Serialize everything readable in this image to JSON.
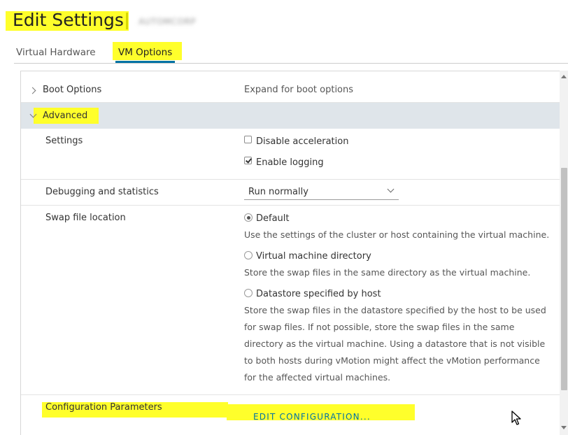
{
  "header": {
    "title": "Edit Settings",
    "vm_name": "AUTOMCORP"
  },
  "tabs": [
    {
      "label": "Virtual Hardware",
      "active": false
    },
    {
      "label": "VM Options",
      "active": true
    }
  ],
  "boot_options": {
    "label": "Boot Options",
    "value": "Expand for boot options"
  },
  "advanced": {
    "label": "Advanced",
    "settings": {
      "label": "Settings",
      "disable_acceleration": {
        "label": "Disable acceleration",
        "checked": false
      },
      "enable_logging": {
        "label": "Enable logging",
        "checked": true
      }
    },
    "debugging": {
      "label": "Debugging and statistics",
      "selected": "Run normally"
    },
    "swap": {
      "label": "Swap file location",
      "options": [
        {
          "label": "Default",
          "checked": true,
          "desc": [
            "Use the settings of the cluster or host containing the virtual machine."
          ]
        },
        {
          "label": "Virtual machine directory",
          "checked": false,
          "desc": [
            "Store the swap files in the same directory as the virtual machine."
          ]
        },
        {
          "label": "Datastore specified by host",
          "checked": false,
          "desc": [
            "Store the swap files in the datastore specified by the host to be used",
            "for swap files. If not possible, store the swap files in the same",
            "directory as the virtual machine. Using a datastore that is not visible",
            "to both hosts during vMotion might affect the vMotion performance",
            "for the affected virtual machines."
          ]
        }
      ]
    },
    "config_params": {
      "label": "Configuration Parameters",
      "button": "EDIT CONFIGURATION..."
    }
  },
  "colors": {
    "highlight": "#ffff2b",
    "accent": "#0072a3",
    "advanced_row": "#dfe5ea"
  }
}
